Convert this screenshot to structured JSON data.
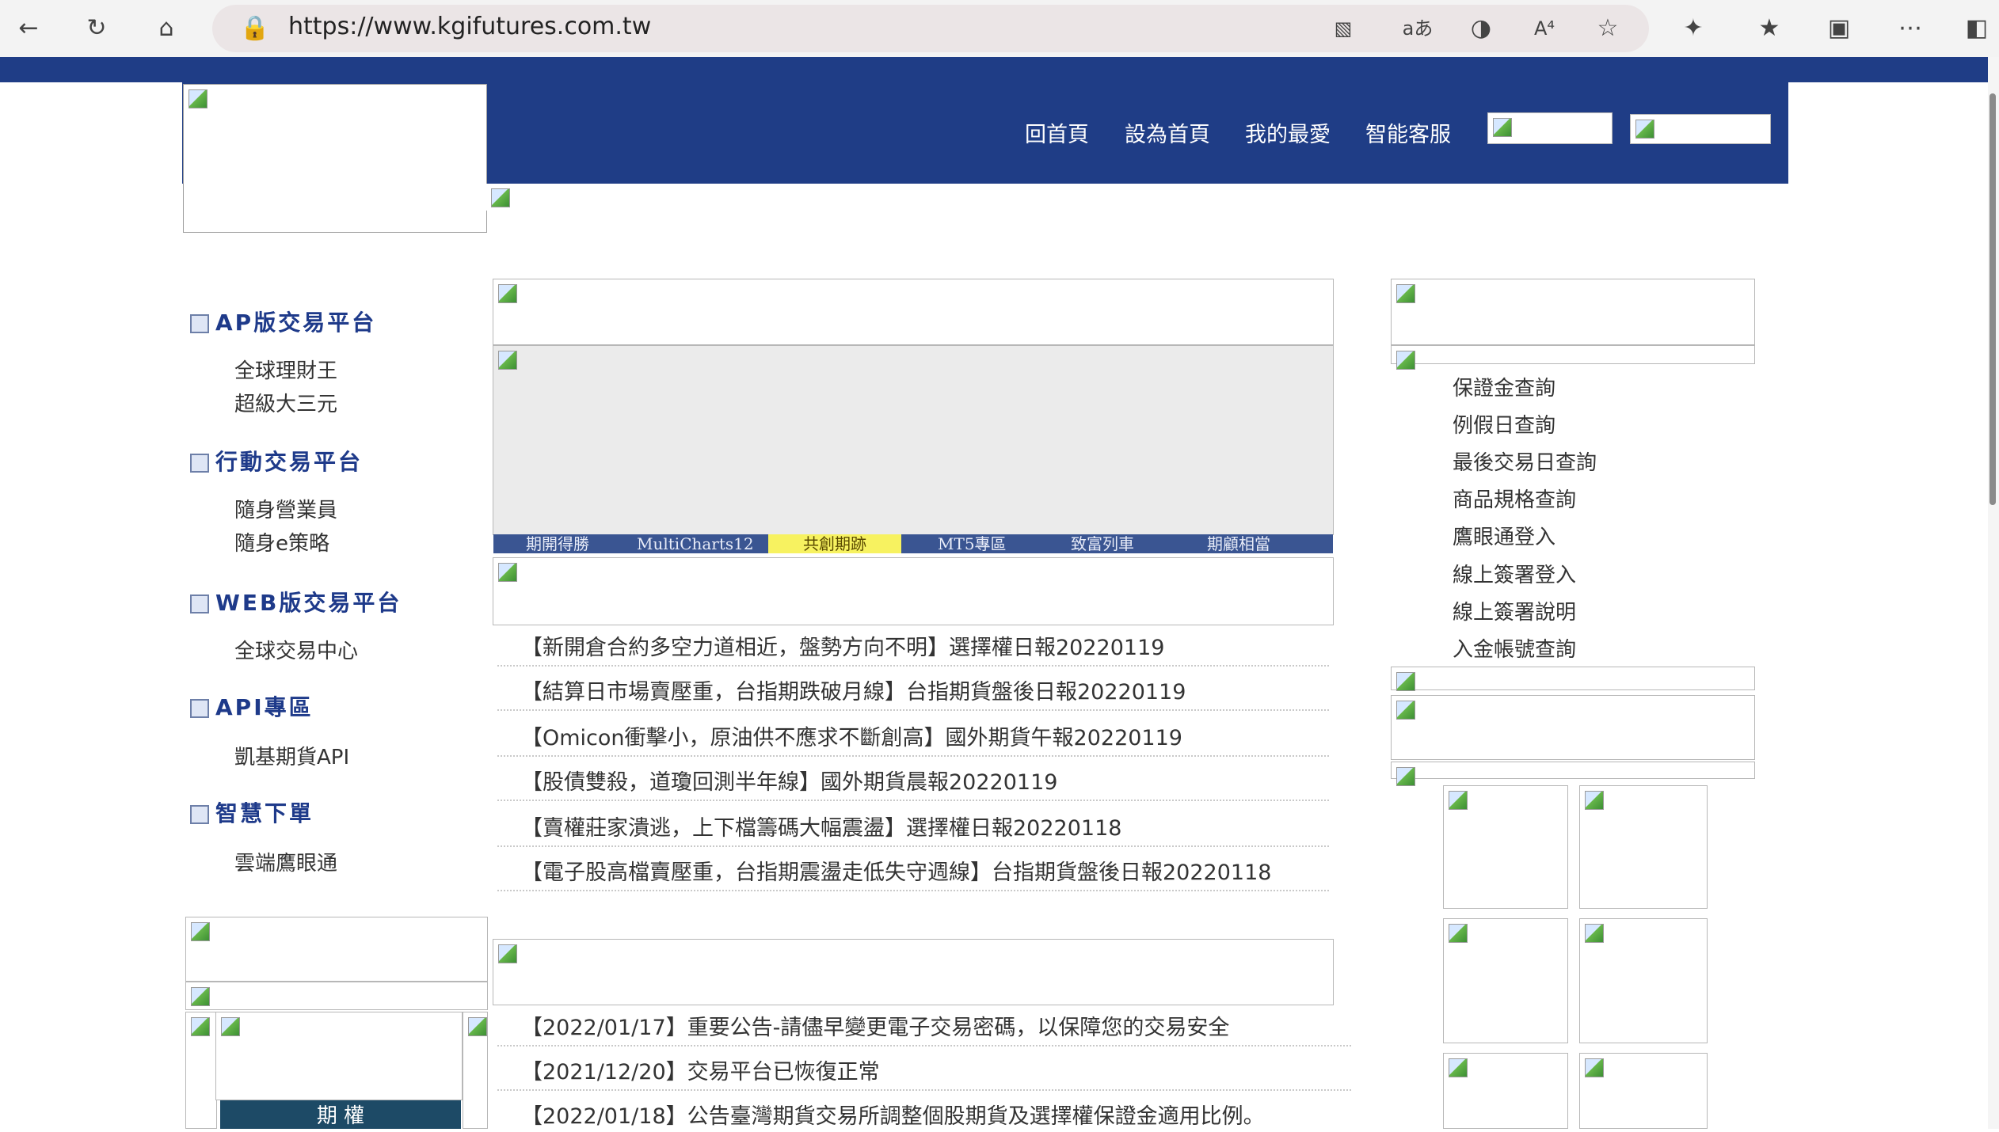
{
  "browser": {
    "url": "https://www.kgifutures.com.tw",
    "icons": [
      "back-icon",
      "refresh-icon",
      "home-icon",
      "lock-icon",
      "camera-off-icon",
      "translate-icon",
      "copilot-icon",
      "read-aloud-icon",
      "favorite-icon",
      "extensions-icon",
      "favorites-list-icon",
      "collections-icon",
      "more-icon",
      "sidebar-icon"
    ]
  },
  "nav": {
    "home": "回首頁",
    "set_home": "設為首頁",
    "favorites": "我的最愛",
    "service": "智能客服"
  },
  "sidebar": {
    "sections": [
      {
        "title": "AP版交易平台",
        "items": [
          "全球理財王",
          "超級大三元"
        ]
      },
      {
        "title": "行動交易平台",
        "items": [
          "隨身營業員",
          "隨身e策略"
        ]
      },
      {
        "title": "WEB版交易平台",
        "items": [
          "全球交易中心"
        ]
      },
      {
        "title": "API專區",
        "items": [
          "凱基期貨API"
        ]
      },
      {
        "title": "智慧下單",
        "items": [
          "雲端鷹眼通"
        ]
      }
    ],
    "bottom_tile_label": "期 權"
  },
  "tabs": [
    {
      "label": "期開得勝",
      "active": false
    },
    {
      "label": "MultiCharts12",
      "active": false
    },
    {
      "label": "共創期跡",
      "active": true
    },
    {
      "label": "MT5專區",
      "active": false
    },
    {
      "label": "致富列車",
      "active": false
    },
    {
      "label": "期顧相當",
      "active": false
    }
  ],
  "reports": [
    "【新開倉合約多空力道相近，盤勢方向不明】選擇權日報20220119",
    "【結算日市場賣壓重，台指期跌破月線】台指期貨盤後日報20220119",
    "【Omicon衝擊小，原油供不應求不斷創高】國外期貨午報20220119",
    "【股債雙殺，道瓊回測半年線】國外期貨晨報20220119",
    "【賣權莊家潰逃，上下檔籌碼大幅震盪】選擇權日報20220118",
    "【電子股高檔賣壓重，台指期震盪走低失守週線】台指期貨盤後日報20220118"
  ],
  "announcements": [
    "【2022/01/17】重要公告-請儘早變更電子交易密碼，以保障您的交易安全",
    "【2021/12/20】交易平台已恢復正常",
    "【2022/01/18】公告臺灣期貨交易所調整個股期貨及選擇權保證金適用比例。"
  ],
  "right_links": [
    "保證金查詢",
    "例假日查詢",
    "最後交易日查詢",
    "商品規格查詢",
    "鷹眼通登入",
    "線上簽署登入",
    "線上簽署說明",
    "入金帳號查詢"
  ],
  "colors": {
    "banner": "#1f3d86",
    "active_tab": "#f7f260",
    "heading": "#1e3a8a"
  }
}
